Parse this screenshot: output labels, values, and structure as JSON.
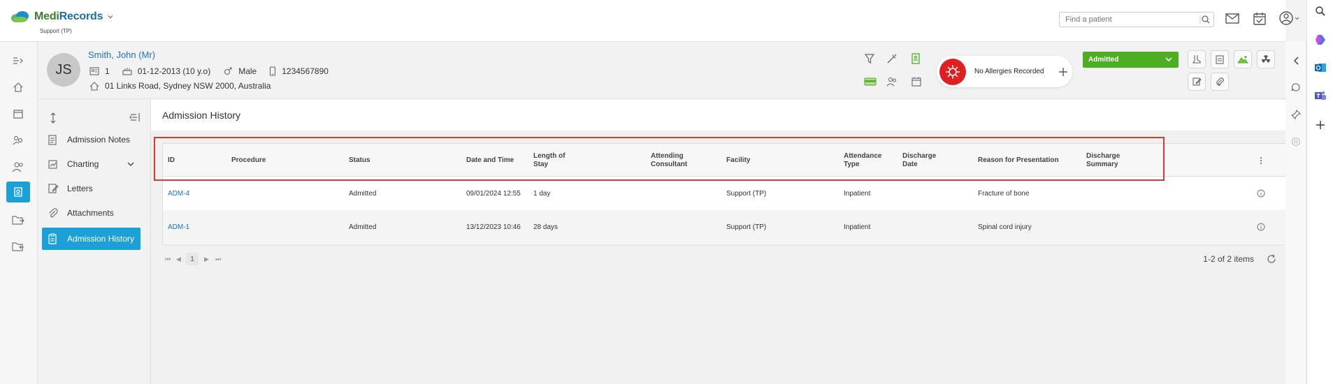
{
  "app": {
    "logo_brand": "MediRecords",
    "logo_part1": "Medi",
    "logo_part2": "Records",
    "location": "Support (TP)"
  },
  "search": {
    "placeholder": "Find a patient"
  },
  "patient": {
    "initials": "JS",
    "name": "Smith, John (Mr)",
    "id": "1",
    "dob": "01-12-2013 (10 y.o)",
    "gender": "Male",
    "phone": "1234567890",
    "address": "01 Links Road, Sydney NSW 2000, Australia"
  },
  "allergy": {
    "label": "No Allergies Recorded"
  },
  "status_dropdown": {
    "value": "Admitted"
  },
  "subnav": {
    "items": [
      {
        "label": "Admission Notes"
      },
      {
        "label": "Charting"
      },
      {
        "label": "Letters"
      },
      {
        "label": "Attachments"
      },
      {
        "label": "Admission History"
      }
    ]
  },
  "page": {
    "title": "Admission History"
  },
  "table": {
    "headers": [
      {
        "l1": "ID",
        "l2": ""
      },
      {
        "l1": "Procedure",
        "l2": ""
      },
      {
        "l1": "Status",
        "l2": ""
      },
      {
        "l1": "Date and Time",
        "l2": ""
      },
      {
        "l1": "Length of",
        "l2": "Stay"
      },
      {
        "l1": "Attending",
        "l2": "Consultant"
      },
      {
        "l1": "Facility",
        "l2": ""
      },
      {
        "l1": "Attendance",
        "l2": "Type"
      },
      {
        "l1": "Discharge",
        "l2": "Date"
      },
      {
        "l1": "Reason for Presentation",
        "l2": ""
      },
      {
        "l1": "Discharge",
        "l2": "Summary"
      }
    ],
    "rows": [
      {
        "id": "ADM-4",
        "procedure": "",
        "status": "Admitted",
        "datetime": "09/01/2024 12:55",
        "los": "1 day",
        "consultant": "",
        "facility": "Support (TP)",
        "attendance": "Inpatient",
        "discharge_date": "",
        "reason": "Fracture of bone",
        "summary": ""
      },
      {
        "id": "ADM-1",
        "procedure": "",
        "status": "Admitted",
        "datetime": "13/12/2023 10:46",
        "los": "28 days",
        "consultant": "",
        "facility": "Support (TP)",
        "attendance": "Inpatient",
        "discharge_date": "",
        "reason": "Spinal cord injury",
        "summary": ""
      }
    ]
  },
  "pager": {
    "first": "⏮",
    "prev": "◀",
    "page": "1",
    "next": "▶",
    "last": "⏭",
    "summary": "1-2 of 2 items"
  },
  "colors": {
    "accent": "#1ba1d8",
    "link": "#1a73c9",
    "admitted": "#4caf23",
    "allergy": "#e02020",
    "highlight": "#e03535"
  }
}
